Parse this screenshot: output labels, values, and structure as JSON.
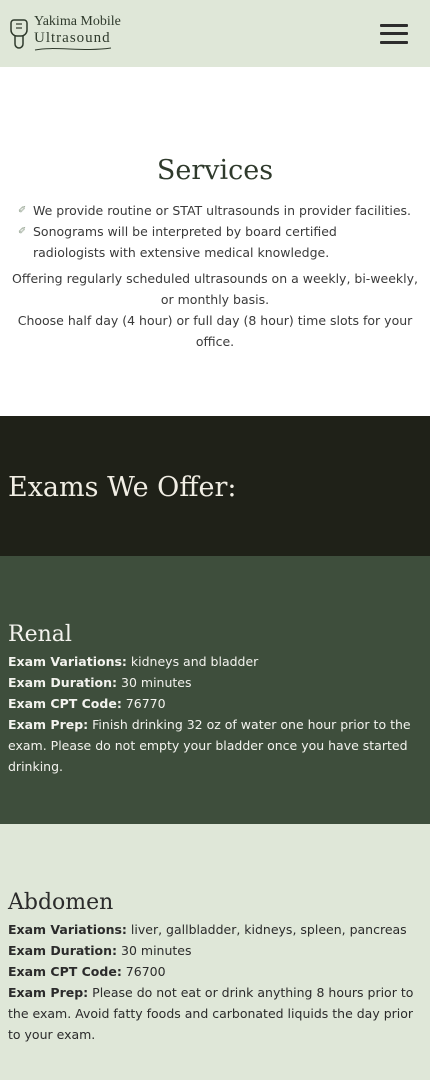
{
  "header": {
    "logo_line1": "Yakima Mobile",
    "logo_line2": "Ultrasound",
    "menu_icon": "hamburger-menu-icon"
  },
  "services": {
    "title": "Services",
    "bullets": [
      "We provide routine or STAT ultrasounds in provider facilities.",
      "Sonograms will be interpreted by board certified radiologists with extensive medical knowledge."
    ],
    "paragraph1": "Offering regularly scheduled ultrasounds on a weekly, bi-weekly, or monthly basis.",
    "paragraph2": "Choose half day (4 hour) or full day (8 hour) time slots for your office."
  },
  "exams_banner": {
    "title": "Exams We Offer:"
  },
  "exams": [
    {
      "name": "Renal",
      "variations_label": "Exam Variations:",
      "variations": "kidneys and bladder",
      "duration_label": "Exam Duration:",
      "duration": "30 minutes",
      "cpt_label": "Exam CPT Code:",
      "cpt": "76770",
      "prep_label": "Exam Prep:",
      "prep": "Finish drinking 32 oz of water one hour prior to the exam. Please do not empty your bladder once you have started drinking."
    },
    {
      "name": "Abdomen",
      "variations_label": "Exam Variations:",
      "variations": "liver, gallbladder, kidneys, spleen, pancreas",
      "duration_label": "Exam Duration:",
      "duration": "30 minutes",
      "cpt_label": "Exam CPT Code:",
      "cpt": "76700",
      "prep_label": "Exam Prep:",
      "prep": "Please do not eat or drink anything 8 hours prior to the exam. Avoid fatty foods and carbonated liquids the day prior to your exam."
    }
  ],
  "colors": {
    "header_bg": "#dfe7d8",
    "dark_banner": "#1f2118",
    "green_section": "#3e4e3c",
    "light_section": "#dfe7d8"
  }
}
